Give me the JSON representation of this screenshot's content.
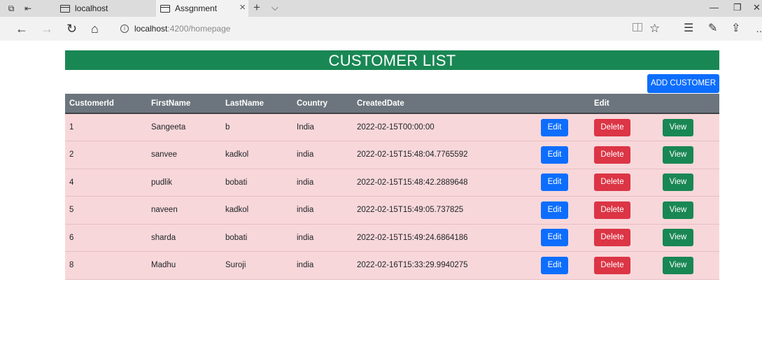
{
  "browser": {
    "tabs": [
      {
        "label": "localhost"
      },
      {
        "label": "Assgnment"
      }
    ],
    "address": {
      "host": "localhost",
      "path": ":4200/homepage"
    }
  },
  "page": {
    "title": "CUSTOMER LIST",
    "add_button": "ADD CUSTOMER",
    "columns": [
      "CustomerId",
      "FirstName",
      "LastName",
      "Country",
      "CreatedDate",
      "",
      "Edit",
      ""
    ],
    "actions": {
      "edit": "Edit",
      "delete": "Delete",
      "view": "View"
    },
    "rows": [
      {
        "id": "1",
        "first": "Sangeeta",
        "last": "b",
        "country": "India",
        "created": "2022-02-15T00:00:00"
      },
      {
        "id": "2",
        "first": "sanvee",
        "last": "kadkol",
        "country": "india",
        "created": "2022-02-15T15:48:04.7765592"
      },
      {
        "id": "4",
        "first": "pudlik",
        "last": "bobati",
        "country": "india",
        "created": "2022-02-15T15:48:42.2889648"
      },
      {
        "id": "5",
        "first": "naveen",
        "last": "kadkol",
        "country": "india",
        "created": "2022-02-15T15:49:05.737825"
      },
      {
        "id": "6",
        "first": "sharda",
        "last": "bobati",
        "country": "india",
        "created": "2022-02-15T15:49:24.6864186"
      },
      {
        "id": "8",
        "first": "Madhu",
        "last": "Suroji",
        "country": "india",
        "created": "2022-02-16T15:33:29.9940275"
      }
    ]
  },
  "colors": {
    "header_green": "#198754",
    "primary_blue": "#0d6efd",
    "danger_red": "#dc3545",
    "table_head": "#6c757d",
    "row_pink": "#f8d7da"
  }
}
